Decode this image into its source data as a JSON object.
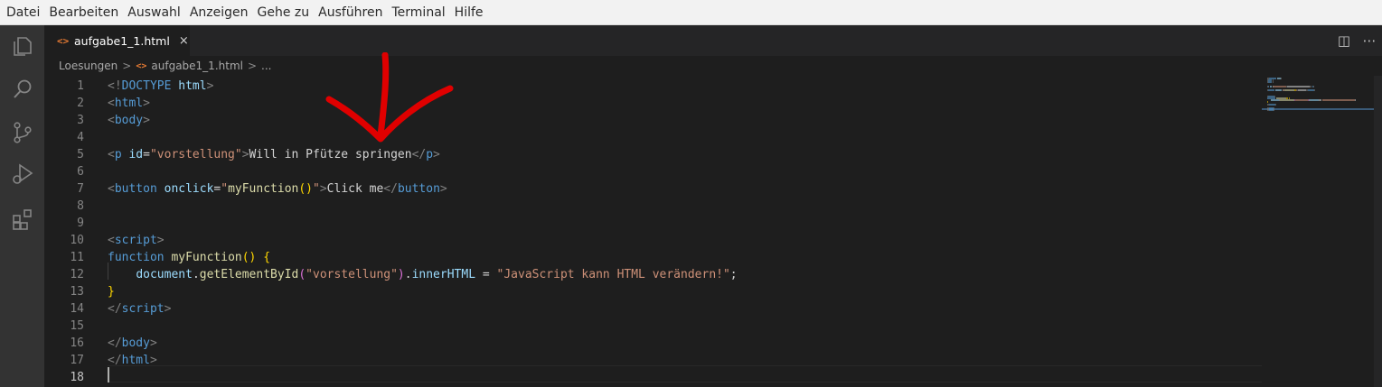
{
  "menu": {
    "items": [
      "Datei",
      "Bearbeiten",
      "Auswahl",
      "Anzeigen",
      "Gehe zu",
      "Ausführen",
      "Terminal",
      "Hilfe"
    ]
  },
  "activitybar": {
    "icons": [
      "explorer-icon",
      "search-icon",
      "source-control-icon",
      "run-debug-icon",
      "extensions-icon"
    ]
  },
  "tab": {
    "icon": "<>",
    "label": "aufgabe1_1.html",
    "close": "×"
  },
  "editor_actions": {
    "split": "◫",
    "more": "⋯"
  },
  "breadcrumbs": {
    "folder": "Loesungen",
    "separator": ">",
    "file_icon": "<>",
    "file": "aufgabe1_1.html",
    "rest": "..."
  },
  "editor": {
    "line_numbers": [
      "1",
      "2",
      "3",
      "4",
      "5",
      "6",
      "7",
      "8",
      "9",
      "10",
      "11",
      "12",
      "13",
      "14",
      "15",
      "16",
      "17",
      "18"
    ],
    "active_line": "18",
    "lines": [
      [
        [
          "t-tag",
          "<!"
        ],
        [
          "t-name",
          "DOCTYPE"
        ],
        [
          "t-text",
          " "
        ],
        [
          "t-attr",
          "html"
        ],
        [
          "t-tag",
          ">"
        ]
      ],
      [
        [
          "t-tag",
          "<"
        ],
        [
          "t-name",
          "html"
        ],
        [
          "t-tag",
          ">"
        ]
      ],
      [
        [
          "t-tag",
          "<"
        ],
        [
          "t-name",
          "body"
        ],
        [
          "t-tag",
          ">"
        ]
      ],
      [],
      [
        [
          "t-tag",
          "<"
        ],
        [
          "t-name",
          "p"
        ],
        [
          "t-text",
          " "
        ],
        [
          "t-attr",
          "id"
        ],
        [
          "t-text",
          "="
        ],
        [
          "t-str",
          "\"vorstellung\""
        ],
        [
          "t-tag",
          ">"
        ],
        [
          "t-text",
          "Will in Pfütze springen"
        ],
        [
          "t-tag",
          "</"
        ],
        [
          "t-name",
          "p"
        ],
        [
          "t-tag",
          ">"
        ]
      ],
      [],
      [
        [
          "t-tag",
          "<"
        ],
        [
          "t-name",
          "button"
        ],
        [
          "t-text",
          " "
        ],
        [
          "t-attr",
          "onclick"
        ],
        [
          "t-text",
          "="
        ],
        [
          "t-str",
          "\""
        ],
        [
          "t-fn",
          "myFunction"
        ],
        [
          "t-brace",
          "()"
        ],
        [
          "t-str",
          "\""
        ],
        [
          "t-tag",
          ">"
        ],
        [
          "t-text",
          "Click me"
        ],
        [
          "t-tag",
          "</"
        ],
        [
          "t-name",
          "button"
        ],
        [
          "t-tag",
          ">"
        ]
      ],
      [],
      [],
      [
        [
          "t-tag",
          "<"
        ],
        [
          "t-name",
          "script"
        ],
        [
          "t-tag",
          ">"
        ]
      ],
      [
        [
          "t-kw",
          "function"
        ],
        [
          "t-text",
          " "
        ],
        [
          "t-fn",
          "myFunction"
        ],
        [
          "t-brace",
          "()"
        ],
        [
          "t-text",
          " "
        ],
        [
          "t-brace",
          "{"
        ]
      ],
      [
        [
          "t-text",
          "    "
        ],
        [
          "t-var",
          "document"
        ],
        [
          "t-text",
          "."
        ],
        [
          "t-fn",
          "getElementById"
        ],
        [
          "t-paren",
          "("
        ],
        [
          "t-str",
          "\"vorstellung\""
        ],
        [
          "t-paren",
          ")"
        ],
        [
          "t-text",
          "."
        ],
        [
          "t-var",
          "innerHTML"
        ],
        [
          "t-text",
          " = "
        ],
        [
          "t-str",
          "\"JavaScript kann HTML verändern!\""
        ],
        [
          "t-text",
          ";"
        ]
      ],
      [
        [
          "t-brace",
          "}"
        ]
      ],
      [
        [
          "t-tag",
          "</"
        ],
        [
          "t-name",
          "script"
        ],
        [
          "t-tag",
          ">"
        ]
      ],
      [],
      [
        [
          "t-tag",
          "</"
        ],
        [
          "t-name",
          "body"
        ],
        [
          "t-tag",
          ">"
        ]
      ],
      [
        [
          "t-tag",
          "</"
        ],
        [
          "t-name",
          "html"
        ],
        [
          "t-tag",
          ">"
        ]
      ],
      []
    ]
  },
  "colors": {
    "accent": "#e37933",
    "annotation": "#e00000",
    "background": "#1e1e1e"
  }
}
